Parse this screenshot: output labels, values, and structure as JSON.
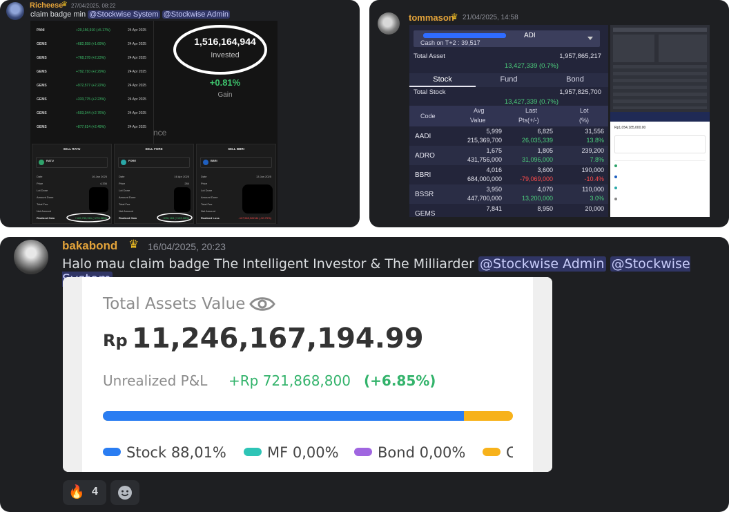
{
  "messages": [
    {
      "username": "Richeese",
      "timestamp": "27/04/2025, 08:22",
      "text": "claim badge min",
      "mentions": [
        "@Stockwise System",
        "@Stockwise Admin"
      ],
      "screenshot": {
        "rows": [
          {
            "symbol": "PANI",
            "change": "+20,156,910 (+5.17%)",
            "date": "24 Apr 2025"
          },
          {
            "symbol": "GEMS",
            "change": "+682,558 (+1.69%)",
            "date": "24 Apr 2025"
          },
          {
            "symbol": "GEMS",
            "change": "+768,278 (+2.23%)",
            "date": "24 Apr 2025"
          },
          {
            "symbol": "GEMS",
            "change": "+792,710 (+2.29%)",
            "date": "24 Apr 2025"
          },
          {
            "symbol": "GEMS",
            "change": "+972,577 (+2.22%)",
            "date": "24 Apr 2025"
          },
          {
            "symbol": "GEMS",
            "change": "+333,775 (+2.23%)",
            "date": "24 Apr 2025"
          },
          {
            "symbol": "GEMS",
            "change": "+503,344 (+2.76%)",
            "date": "24 Apr 2025"
          },
          {
            "symbol": "GEMS",
            "change": "+877,614 (+2.49%)",
            "date": "24 Apr 2025"
          }
        ],
        "invested_value": "1,516,164,944",
        "invested_label": "Invested",
        "gain_value": "+0.81%",
        "gain_label": "Gain",
        "partial_text": "nce",
        "panels": [
          {
            "title": "SELL RATU",
            "stock": "RATU",
            "stock_color": "#2fa36b",
            "date": "16 Jan 2025",
            "price": "4,336",
            "result_label": "Realized Gain",
            "result_value": "+169,755,961 (+276.58%)",
            "result_color": "#3ec46d"
          },
          {
            "title": "SELL FORE",
            "stock": "FORE",
            "stock_color": "#2aa8a8",
            "date": "16 Apr 2025",
            "price": "284",
            "result_label": "Realized Gain",
            "result_value": "+226,163 (+103.18%)",
            "result_color": "#3ec46d"
          },
          {
            "title": "SELL BBRI",
            "stock": "BBRI",
            "stock_color": "#1f5fbf",
            "date": "13 Jan 2025",
            "price": "",
            "result_label": "Realized Loss",
            "result_value": "-117,569,562.84 (-30.79%)",
            "result_color": "#ff4b4b"
          }
        ],
        "panel_labels": [
          "Date",
          "Price",
          "Lot Done",
          "Amount Done",
          "Total Fee",
          "Net Amount"
        ]
      }
    },
    {
      "username": "tommason",
      "timestamp": "21/04/2025, 14:58",
      "screenshot": {
        "account_code": "ADI",
        "cash_label": "Cash on T+2 : 39,517",
        "total_asset_label": "Total Asset",
        "total_asset_value": "1,957,865,217",
        "total_asset_change": "13,427,339 (0.7%)",
        "tabs": [
          "Stock",
          "Fund",
          "Bond"
        ],
        "total_stock_label": "Total Stock",
        "total_stock_value": "1,957,825,700",
        "total_stock_change": "13,427,339 (0.7%)",
        "headers": {
          "code": "Code",
          "avg": "Avg",
          "value": "Value",
          "last": "Last",
          "pts": "Pts(+/-)",
          "lot": "Lot",
          "pct": "(%)"
        },
        "rows": [
          {
            "code": "AADI",
            "avg": "5,999",
            "value": "215,369,700",
            "last": "6,825",
            "pts": "26,035,339",
            "lot": "31,556",
            "pct": "13.8%",
            "dir": "pos"
          },
          {
            "code": "ADRO",
            "avg": "1,675",
            "value": "431,756,000",
            "last": "1,805",
            "pts": "31,096,000",
            "lot": "239,200",
            "pct": "7.8%",
            "dir": "pos"
          },
          {
            "code": "BBRI",
            "avg": "4,016",
            "value": "684,000,000",
            "last": "3,600",
            "pts": "-79,069,000",
            "lot": "190,000",
            "pct": "-10.4%",
            "dir": "neg"
          },
          {
            "code": "BSSR",
            "avg": "3,950",
            "value": "447,700,000",
            "last": "4,070",
            "pts": "13,200,000",
            "lot": "110,000",
            "pct": "3.0%",
            "dir": "pos"
          },
          {
            "code": "GEMS",
            "avg": "7,841",
            "value": "",
            "last": "8,950",
            "pts": "",
            "lot": "20,000",
            "pct": "",
            "dir": "pos"
          }
        ],
        "mini_total": "Rp1,054,185,000.00"
      }
    },
    {
      "username": "bakabond",
      "timestamp": "16/04/2025, 20:23",
      "text": "Halo mau claim badge The Intelligent Investor & The Milliarder",
      "mentions": [
        "@Stockwise Admin",
        "@Stockwise System"
      ],
      "embed": {
        "label": "Total Assets Value",
        "currency": "Rp",
        "value": "11,246,167,194.99",
        "pl_label": "Unrealized P&L",
        "pl_value": "+Rp 721,868,800",
        "pl_percent": "(+6.85%)",
        "allocation": [
          {
            "name": "Stock",
            "percent_text": "88,01%",
            "fraction": 0.8801,
            "color": "#2a7df2"
          },
          {
            "name": "MF",
            "percent_text": "0,00%",
            "fraction": 0,
            "color": "#2ec4b6"
          },
          {
            "name": "Bond",
            "percent_text": "0,00%",
            "fraction": 0,
            "color": "#a066e0"
          },
          {
            "name": "C",
            "percent_text": "",
            "fraction": 0.1199,
            "color": "#f7b21b"
          }
        ]
      },
      "reactions": [
        {
          "emoji": "🔥",
          "count": "4"
        }
      ]
    }
  ]
}
